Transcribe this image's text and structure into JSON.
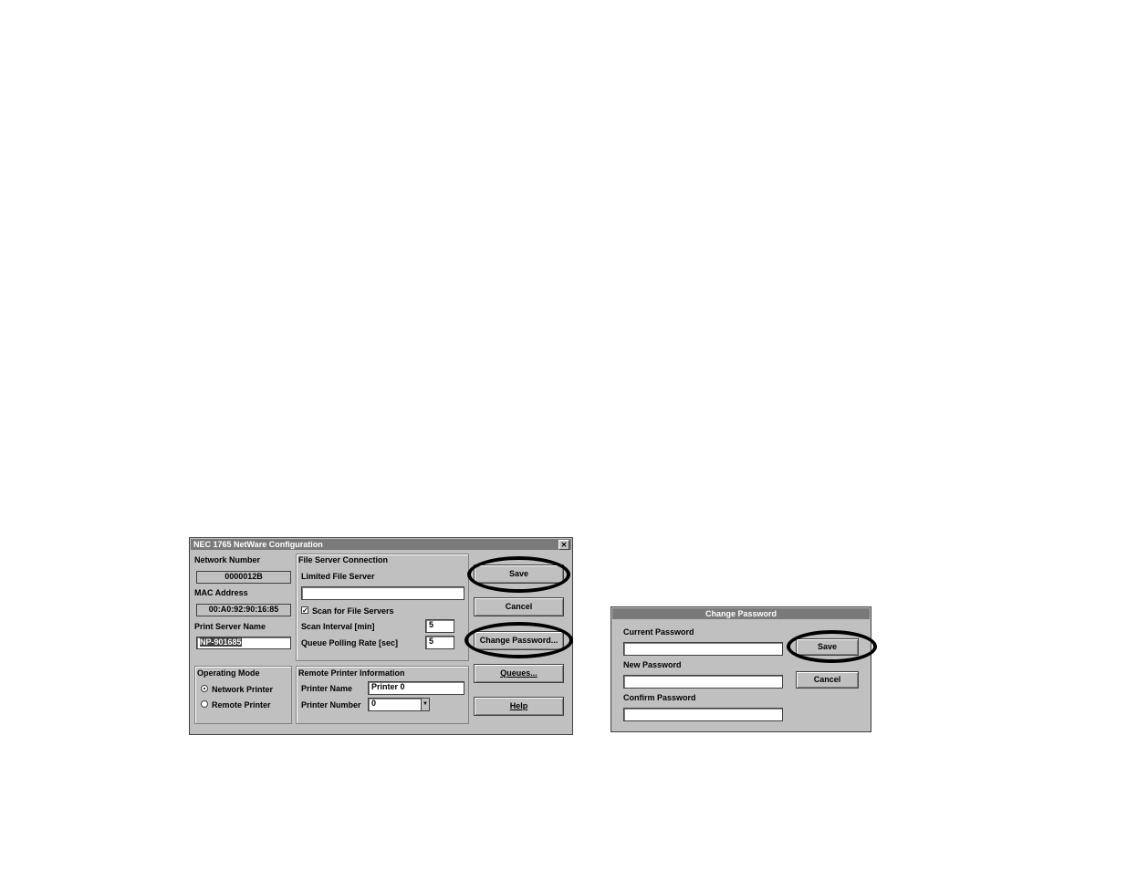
{
  "config": {
    "title": "NEC 1765 NetWare Configuration",
    "close_glyph": "✕",
    "network_number_label": "Network Number",
    "network_number_value": "0000012B",
    "mac_label": "MAC Address",
    "mac_value": "00:A0:92:90:16:85",
    "psname_label": "Print Server Name",
    "psname_value": "NP-901685",
    "fsc_title": "File Server Connection",
    "limited_label": "Limited File Server",
    "limited_value": "",
    "scan_label": "Scan for File Servers",
    "scan_checked": true,
    "scan_interval_label": "Scan Interval [min]",
    "scan_interval_value": "5",
    "queue_polling_label": "Queue Polling Rate [sec]",
    "queue_polling_value": "5",
    "opmode_title": "Operating Mode",
    "network_printer_label": "Network Printer",
    "remote_printer_label": "Remote Printer",
    "selected_mode": "Network Printer",
    "rpi_title": "Remote Printer Information",
    "printer_name_label": "Printer Name",
    "printer_name_value": "Printer 0",
    "printer_number_label": "Printer Number",
    "printer_number_value": "0",
    "buttons": {
      "save": "Save",
      "cancel": "Cancel",
      "change_password": "Change Password...",
      "queues": "Queues...",
      "help": "Help"
    }
  },
  "change_password": {
    "title": "Change Password",
    "current_label": "Current Password",
    "current_value": "",
    "new_label": "New Password",
    "new_value": "",
    "confirm_label": "Confirm Password",
    "confirm_value": "",
    "buttons": {
      "save": "Save",
      "cancel": "Cancel"
    }
  }
}
